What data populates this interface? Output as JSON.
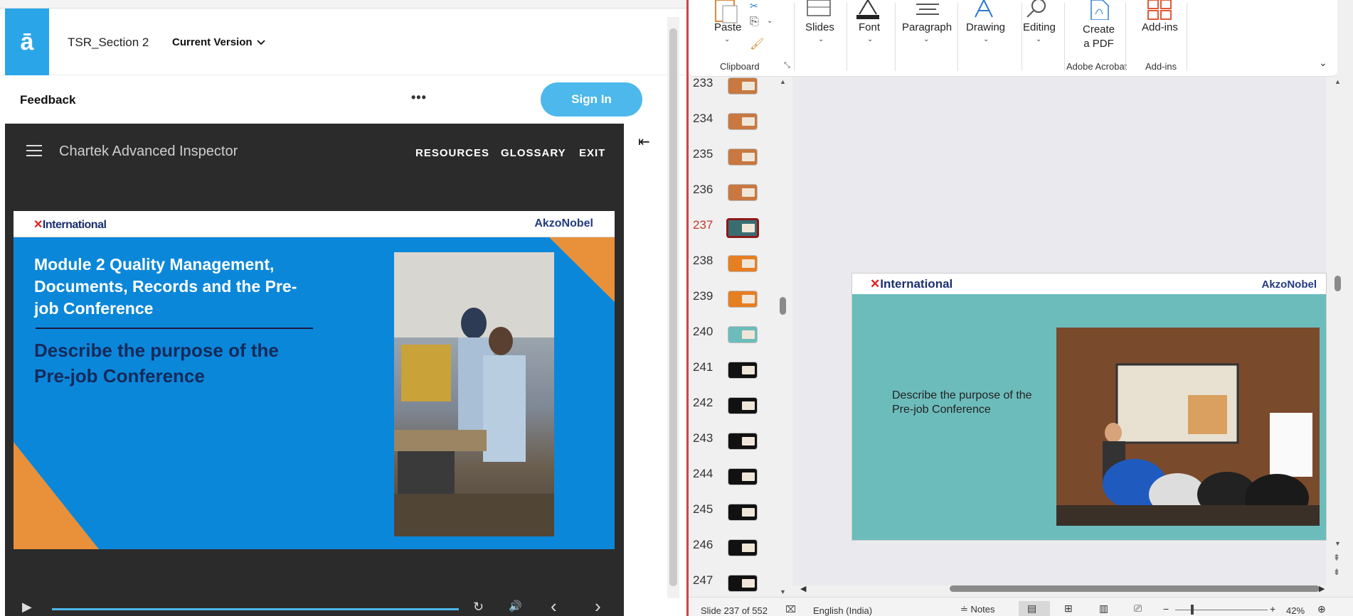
{
  "left": {
    "logo": "ā",
    "course_title": "TSR_Section 2",
    "version": "Current Version",
    "feedback": "Feedback",
    "more": "•••",
    "sign_in": "Sign In",
    "player_title": "Chartek Advanced Inspector",
    "nav": [
      "RESOURCES",
      "GLOSSARY",
      "EXIT"
    ],
    "slide": {
      "brand_left": "International",
      "brand_right": "AkzoNobel",
      "title": "Module 2 Quality Management, Documents, Records and the Pre-job Conference",
      "subtitle": "Describe the purpose of the Pre-job Conference"
    },
    "controls": {
      "play": "▶",
      "replay": "↻",
      "volume": "🔊",
      "prev": "‹",
      "next": "›"
    }
  },
  "right": {
    "ribbon": {
      "paste": "Paste",
      "slides": "Slides",
      "font": "Font",
      "paragraph": "Paragraph",
      "drawing": "Drawing",
      "editing": "Editing",
      "create_pdf_line1": "Create",
      "create_pdf_line2": "a PDF",
      "addins": "Add-ins",
      "group_clipboard": "Clipboard",
      "group_acrobat": "Adobe Acrobat",
      "group_addins": "Add-ins"
    },
    "thumbnails": [
      {
        "num": "233",
        "color": "#c87840"
      },
      {
        "num": "234",
        "color": "#c87840"
      },
      {
        "num": "235",
        "color": "#c87840"
      },
      {
        "num": "236",
        "color": "#c87840"
      },
      {
        "num": "237",
        "color": "#3a6d72",
        "selected": true
      },
      {
        "num": "238",
        "color": "#e67e22"
      },
      {
        "num": "239",
        "color": "#e67e22"
      },
      {
        "num": "240",
        "color": "#6dbcbc"
      },
      {
        "num": "241",
        "color": "#111111"
      },
      {
        "num": "242",
        "color": "#111111"
      },
      {
        "num": "243",
        "color": "#111111"
      },
      {
        "num": "244",
        "color": "#111111"
      },
      {
        "num": "245",
        "color": "#111111"
      },
      {
        "num": "246",
        "color": "#111111"
      },
      {
        "num": "247",
        "color": "#111111"
      }
    ],
    "slide": {
      "brand_left": "International",
      "brand_right": "AkzoNobel",
      "text": "Describe the purpose of the Pre-job Conference"
    },
    "status": {
      "slide": "Slide 237 of 552",
      "language": "English (India)",
      "notes": "Notes",
      "zoom": "42%"
    }
  }
}
